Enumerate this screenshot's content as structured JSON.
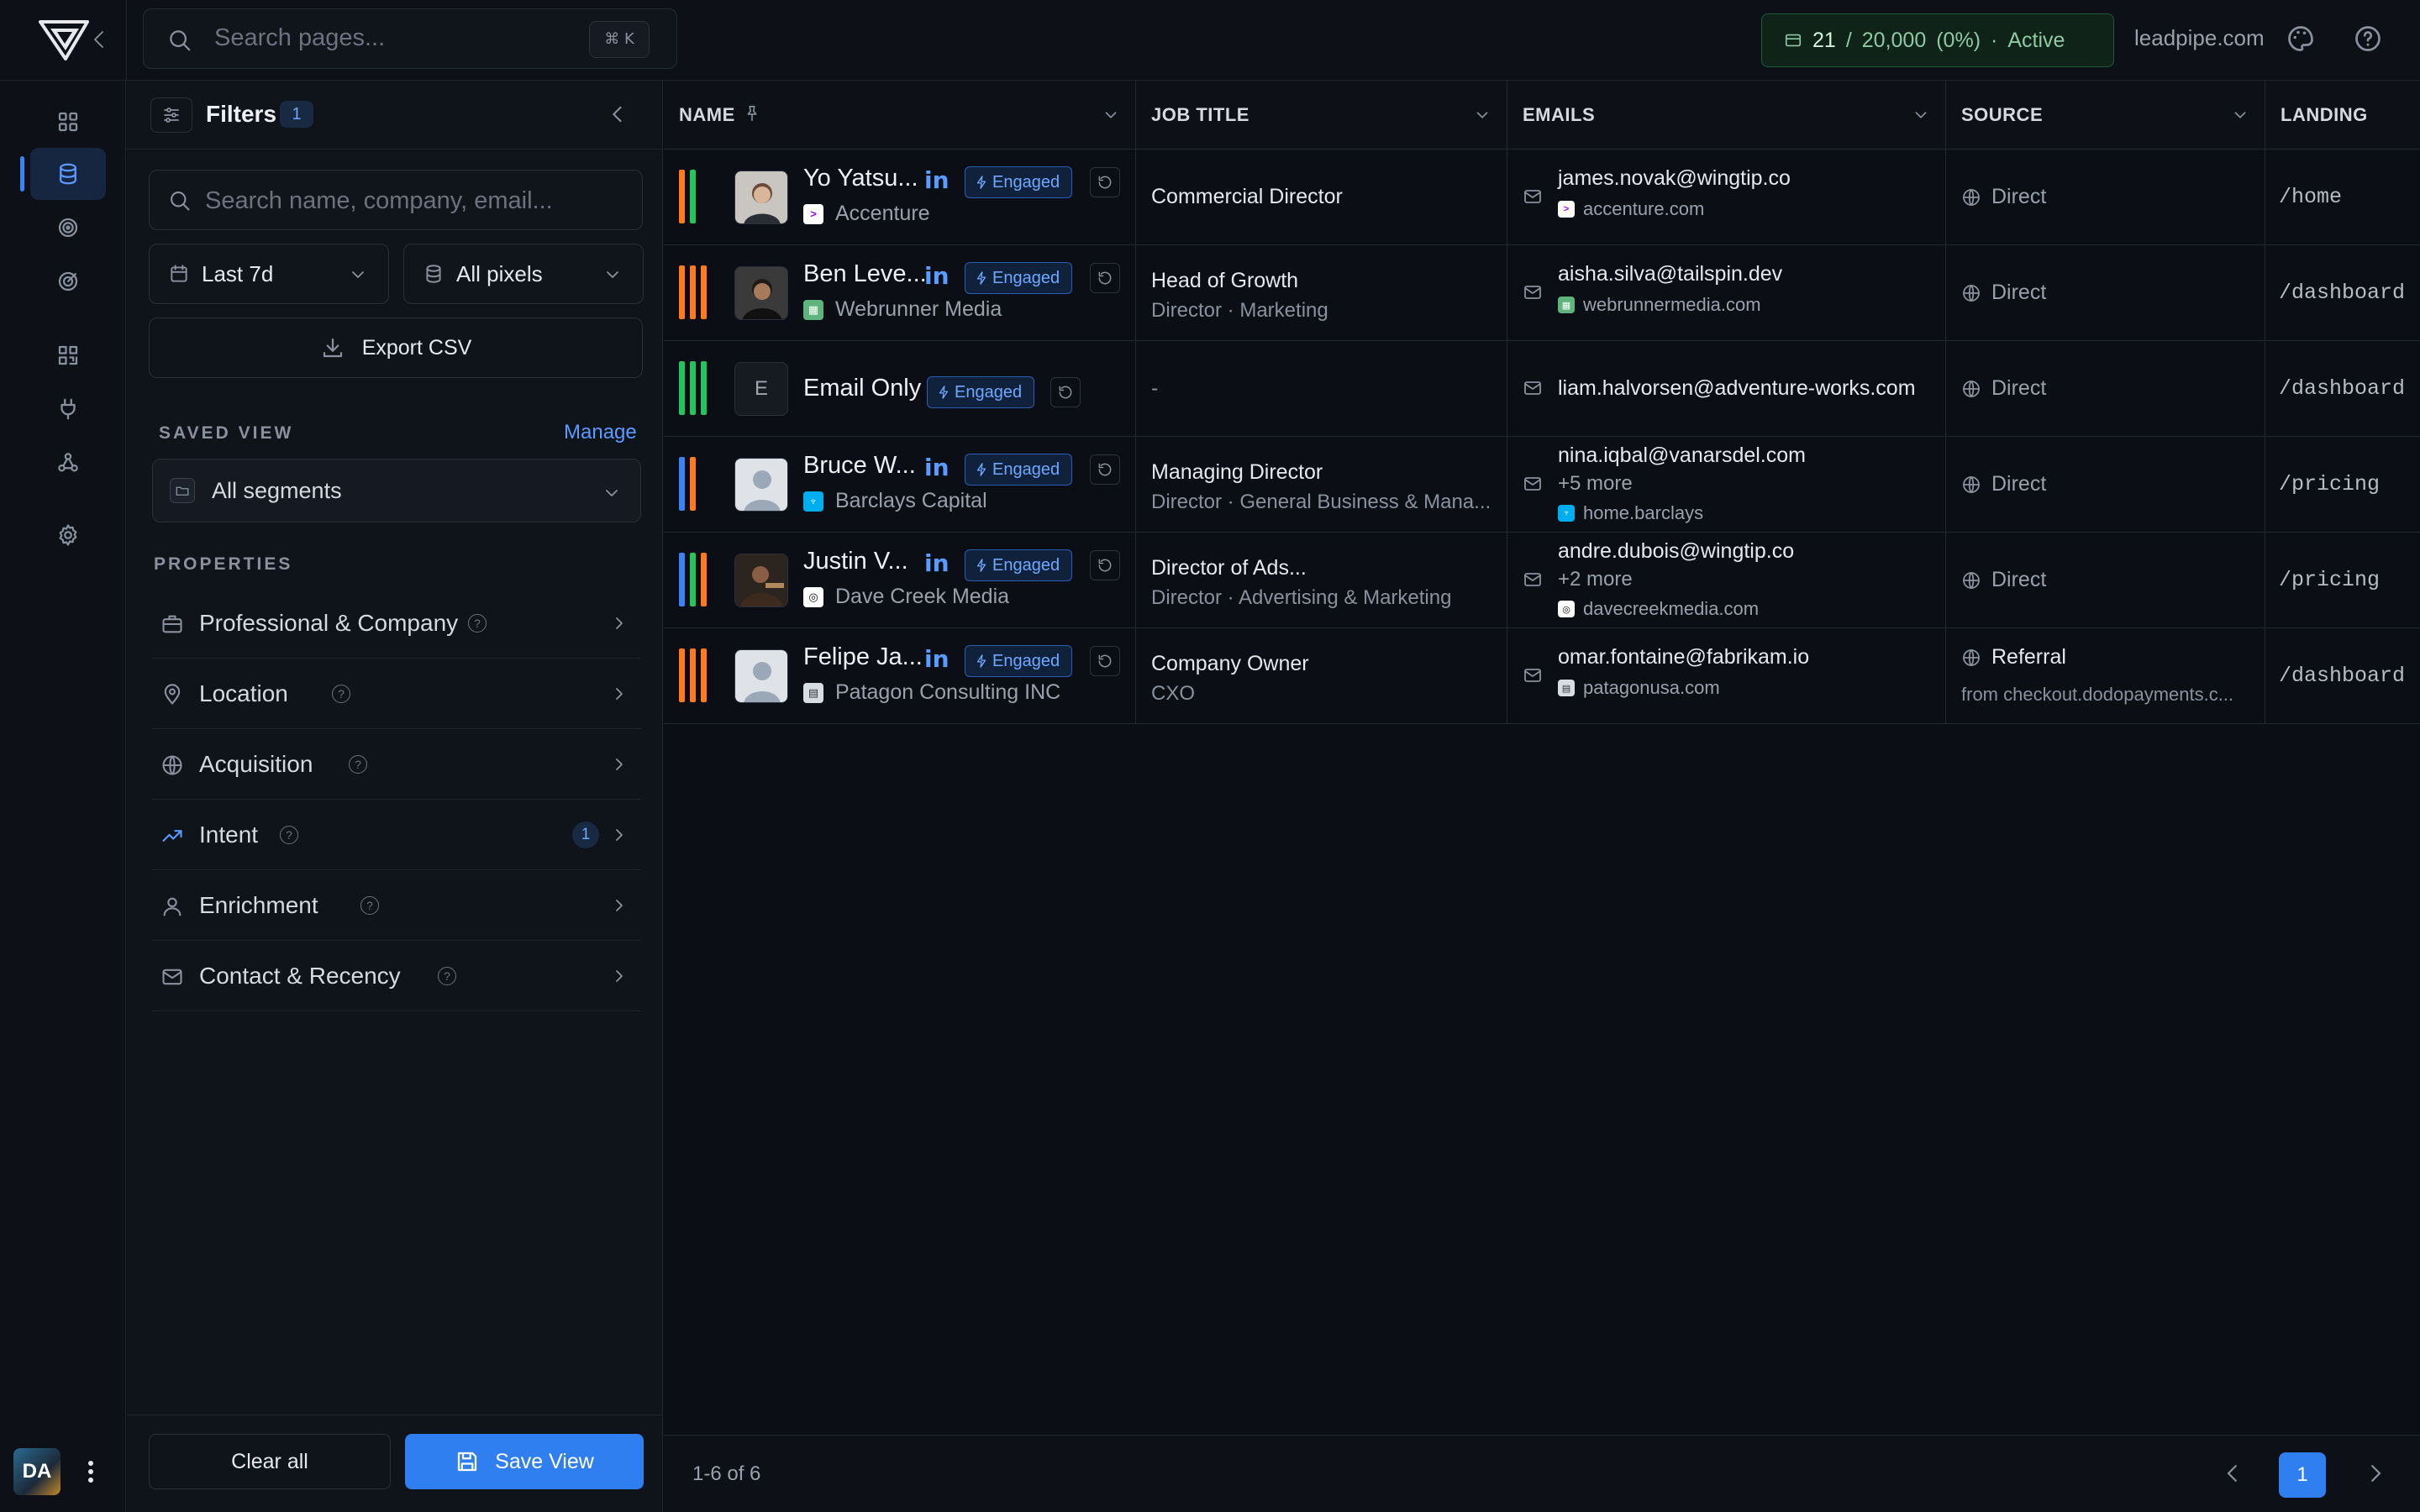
{
  "topbar": {
    "search_placeholder": "Search pages...",
    "shortcut": "⌘ K",
    "credits": {
      "used": "21",
      "sep": "/",
      "total": "20,000",
      "percent": "(0%)",
      "dot": "·",
      "status": "Active"
    },
    "domain": "leadpipe.com"
  },
  "filters": {
    "title": "Filters",
    "count": "1",
    "search_placeholder": "Search name, company, email...",
    "date_range": "Last 7d",
    "pixels": "All pixels",
    "export_label": "Export CSV",
    "saved_view_label": "SAVED VIEW",
    "manage_label": "Manage",
    "segments": "All segments",
    "properties_label": "PROPERTIES",
    "properties": [
      {
        "label": "Professional & Company",
        "badge": ""
      },
      {
        "label": "Location",
        "badge": ""
      },
      {
        "label": "Acquisition",
        "badge": ""
      },
      {
        "label": "Intent",
        "badge": "1"
      },
      {
        "label": "Enrichment",
        "badge": ""
      },
      {
        "label": "Contact & Recency",
        "badge": ""
      }
    ],
    "clear_label": "Clear all",
    "save_label": "Save View"
  },
  "table": {
    "columns": [
      "NAME",
      "JOB TITLE",
      "EMAILS",
      "SOURCE",
      "LANDING"
    ],
    "engaged_label": "Engaged",
    "rows": [
      {
        "name": "Yo Yatsu...",
        "company": "Accenture",
        "title": "Commercial Director",
        "title_sub": "",
        "email": "james.novak@wingtip.co",
        "email_more": "",
        "email_domain": "accenture.com",
        "source": "Direct",
        "source_sub": "",
        "landing": "/home",
        "bars": [
          "#ff7a1a",
          "#22c55e"
        ]
      },
      {
        "name": "Ben Leve...",
        "company": "Webrunner Media",
        "title": "Head of Growth",
        "title_sub": "Director · Marketing",
        "email": "aisha.silva@tailspin.dev",
        "email_more": "",
        "email_domain": "webrunnermedia.com",
        "source": "Direct",
        "source_sub": "",
        "landing": "/dashboard",
        "bars": [
          "#ff7a1a",
          "#ff7a1a",
          "#ff7a1a"
        ]
      },
      {
        "name": "Email Only",
        "avatar_letter": "E",
        "company": "",
        "title": "-",
        "title_sub": "",
        "email": "liam.halvorsen@adventure-works.com",
        "email_more": "",
        "email_domain": "",
        "source": "Direct",
        "source_sub": "",
        "landing": "/dashboard",
        "bars": [
          "#22c55e",
          "#22c55e",
          "#22c55e"
        ]
      },
      {
        "name": "Bruce W...",
        "company": "Barclays Capital",
        "title": "Managing Director",
        "title_sub": "Director · General Business & Mana...",
        "email": "nina.iqbal@vanarsdel.com",
        "email_more": "+5 more",
        "email_domain": "home.barclays",
        "source": "Direct",
        "source_sub": "",
        "landing": "/pricing",
        "bars": [
          "#3b82f6",
          "#ff7a1a"
        ]
      },
      {
        "name": "Justin V...",
        "company": "Dave Creek Media",
        "title": "Director of Ads...",
        "title_sub": "Director · Advertising & Marketing",
        "email": "andre.dubois@wingtip.co",
        "email_more": "+2 more",
        "email_domain": "davecreekmedia.com",
        "source": "Direct",
        "source_sub": "",
        "landing": "/pricing",
        "bars": [
          "#3b82f6",
          "#22c55e",
          "#ff7a1a"
        ]
      },
      {
        "name": "Felipe Ja...",
        "company": "Patagon Consulting INC",
        "title": "Company Owner",
        "title_sub": "CXO",
        "email": "omar.fontaine@fabrikam.io",
        "email_more": "",
        "email_domain": "patagonusa.com",
        "source": "Referral",
        "source_sub": "from checkout.dodopayments.c...",
        "landing": "/dashboard",
        "bars": [
          "#ff7a1a",
          "#ff7a1a",
          "#ff7a1a"
        ]
      }
    ],
    "range": "1-6 of 6",
    "page": "1"
  },
  "user": {
    "initials": "DA"
  }
}
